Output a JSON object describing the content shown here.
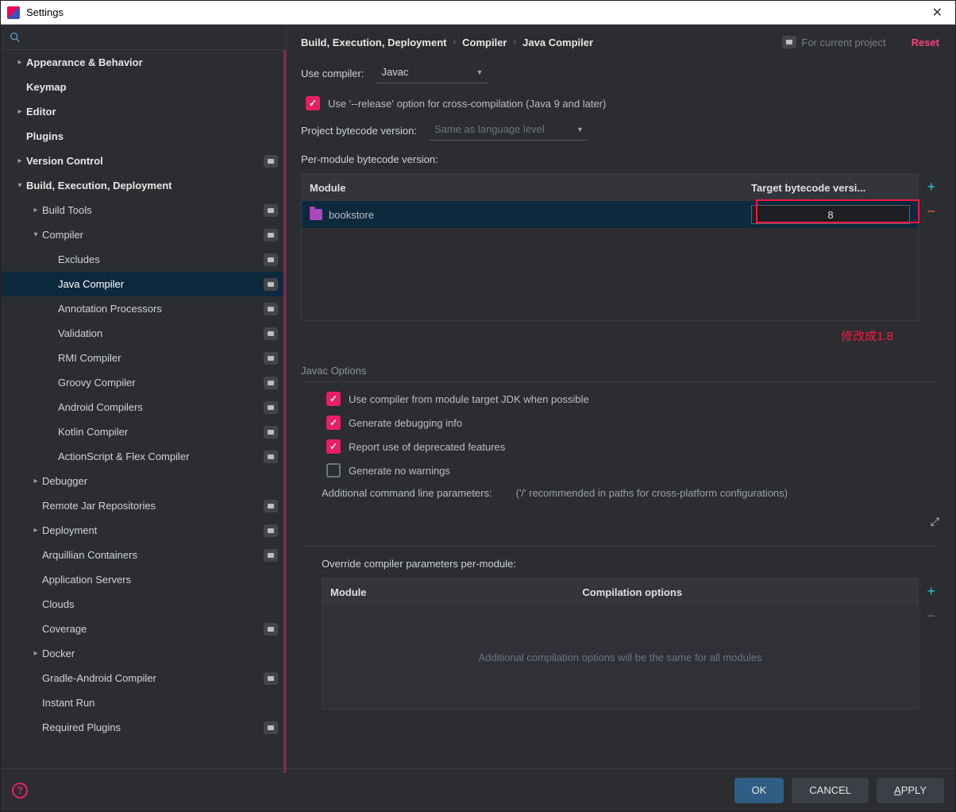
{
  "window": {
    "title": "Settings"
  },
  "sidebar": {
    "items": [
      {
        "label": "Appearance & Behavior",
        "indent": 0,
        "arrow": "right",
        "bold": true,
        "badge": false
      },
      {
        "label": "Keymap",
        "indent": 0,
        "arrow": "",
        "bold": true,
        "badge": false
      },
      {
        "label": "Editor",
        "indent": 0,
        "arrow": "right",
        "bold": true,
        "badge": false
      },
      {
        "label": "Plugins",
        "indent": 0,
        "arrow": "",
        "bold": true,
        "badge": false
      },
      {
        "label": "Version Control",
        "indent": 0,
        "arrow": "right",
        "bold": true,
        "badge": true
      },
      {
        "label": "Build, Execution, Deployment",
        "indent": 0,
        "arrow": "down",
        "bold": true,
        "badge": false
      },
      {
        "label": "Build Tools",
        "indent": 1,
        "arrow": "right",
        "bold": false,
        "badge": true
      },
      {
        "label": "Compiler",
        "indent": 1,
        "arrow": "down",
        "bold": false,
        "badge": true
      },
      {
        "label": "Excludes",
        "indent": 2,
        "arrow": "",
        "bold": false,
        "badge": true
      },
      {
        "label": "Java Compiler",
        "indent": 2,
        "arrow": "",
        "bold": false,
        "badge": true,
        "selected": true
      },
      {
        "label": "Annotation Processors",
        "indent": 2,
        "arrow": "",
        "bold": false,
        "badge": true
      },
      {
        "label": "Validation",
        "indent": 2,
        "arrow": "",
        "bold": false,
        "badge": true
      },
      {
        "label": "RMI Compiler",
        "indent": 2,
        "arrow": "",
        "bold": false,
        "badge": true
      },
      {
        "label": "Groovy Compiler",
        "indent": 2,
        "arrow": "",
        "bold": false,
        "badge": true
      },
      {
        "label": "Android Compilers",
        "indent": 2,
        "arrow": "",
        "bold": false,
        "badge": true
      },
      {
        "label": "Kotlin Compiler",
        "indent": 2,
        "arrow": "",
        "bold": false,
        "badge": true
      },
      {
        "label": "ActionScript & Flex Compiler",
        "indent": 2,
        "arrow": "",
        "bold": false,
        "badge": true
      },
      {
        "label": "Debugger",
        "indent": 1,
        "arrow": "right",
        "bold": false,
        "badge": false
      },
      {
        "label": "Remote Jar Repositories",
        "indent": 1,
        "arrow": "",
        "bold": false,
        "badge": true
      },
      {
        "label": "Deployment",
        "indent": 1,
        "arrow": "right",
        "bold": false,
        "badge": true
      },
      {
        "label": "Arquillian Containers",
        "indent": 1,
        "arrow": "",
        "bold": false,
        "badge": true
      },
      {
        "label": "Application Servers",
        "indent": 1,
        "arrow": "",
        "bold": false,
        "badge": false
      },
      {
        "label": "Clouds",
        "indent": 1,
        "arrow": "",
        "bold": false,
        "badge": false
      },
      {
        "label": "Coverage",
        "indent": 1,
        "arrow": "",
        "bold": false,
        "badge": true
      },
      {
        "label": "Docker",
        "indent": 1,
        "arrow": "right",
        "bold": false,
        "badge": false
      },
      {
        "label": "Gradle-Android Compiler",
        "indent": 1,
        "arrow": "",
        "bold": false,
        "badge": true
      },
      {
        "label": "Instant Run",
        "indent": 1,
        "arrow": "",
        "bold": false,
        "badge": false
      },
      {
        "label": "Required Plugins",
        "indent": 1,
        "arrow": "",
        "bold": false,
        "badge": true
      }
    ]
  },
  "breadcrumb": {
    "a": "Build, Execution, Deployment",
    "b": "Compiler",
    "c": "Java Compiler",
    "scope": "For current project",
    "reset": "Reset"
  },
  "compiler": {
    "use_compiler_label": "Use compiler:",
    "use_compiler_value": "Javac",
    "release_checkbox": "Use '--release' option for cross-compilation (Java 9 and later)",
    "project_bc_label": "Project bytecode version:",
    "project_bc_value": "Same as language level",
    "per_module_label": "Per-module bytecode version:",
    "table": {
      "col_module": "Module",
      "col_target": "Target bytecode versi...",
      "row_module": "bookstore",
      "row_target": "8"
    },
    "annotation": "修改成1.8"
  },
  "javac": {
    "title": "Javac Options",
    "opt1": "Use compiler from module target JDK when possible",
    "opt2": "Generate debugging info",
    "opt3": "Report use of deprecated features",
    "opt4": "Generate no warnings",
    "params_label": "Additional command line parameters:",
    "params_hint": "('/' recommended in paths for cross-platform configurations)"
  },
  "override": {
    "label": "Override compiler parameters per-module:",
    "col_module": "Module",
    "col_opts": "Compilation options",
    "placeholder": "Additional compilation options will be the same for all modules"
  },
  "footer": {
    "ok": "OK",
    "cancel": "CANCEL",
    "apply": "APPLY",
    "apply_ul": "A",
    "apply_rest": "PPLY"
  }
}
